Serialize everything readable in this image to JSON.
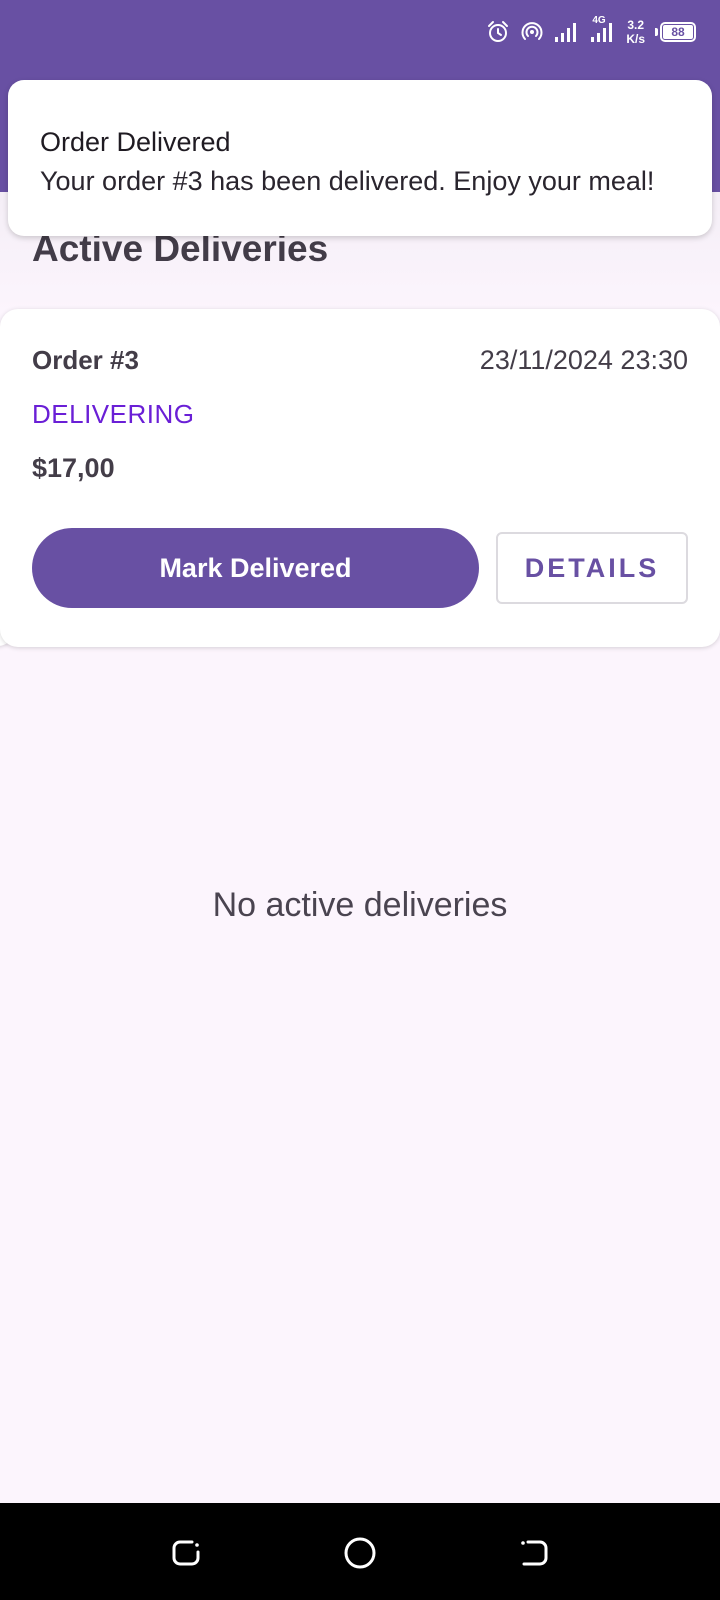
{
  "status_bar": {
    "network": "4G",
    "speed_value": "3.2",
    "speed_unit": "K/s",
    "battery": "88",
    "icons": [
      "alarm-icon",
      "hotspot-icon",
      "signal-icon",
      "signal-4g-icon"
    ]
  },
  "notification": {
    "title": "Order Delivered",
    "body": "Your order #3 has been delivered. Enjoy your meal!"
  },
  "page": {
    "title": "Active Deliveries"
  },
  "order_card": {
    "order_label": "Order #3",
    "timestamp": "23/11/2024 23:30",
    "status": "DELIVERING",
    "price": "$17,00",
    "primary_action": "Mark Delivered",
    "secondary_action": "DETAILS"
  },
  "empty_state": {
    "message": "No active deliveries"
  },
  "navigation": {
    "icons": [
      "recents-icon",
      "home-icon",
      "back-icon"
    ]
  },
  "colors": {
    "primary": "#6850a3",
    "status_accent": "#6a1fd6",
    "background": "#fcf5fd"
  }
}
